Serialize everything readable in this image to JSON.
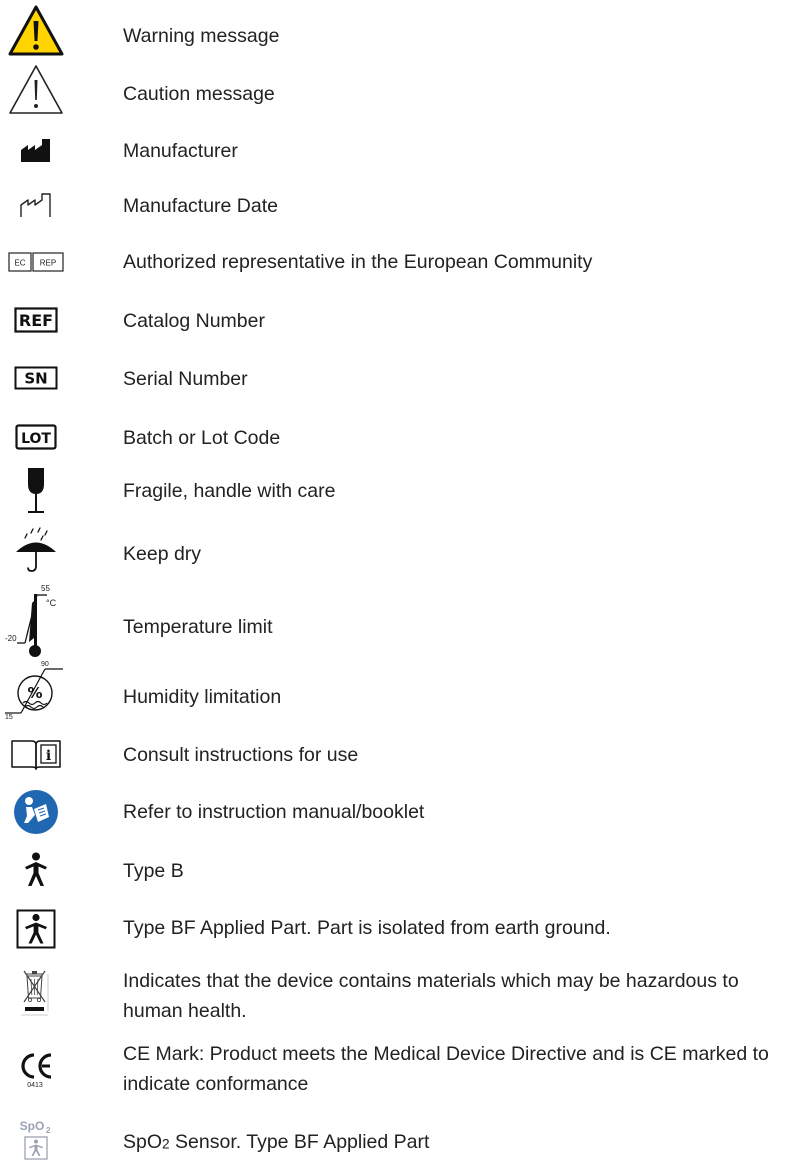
{
  "symbols": [
    {
      "icon": "warning-icon",
      "label": "Warning message"
    },
    {
      "icon": "caution-icon",
      "label": "Caution message"
    },
    {
      "icon": "manufacturer-icon",
      "label": "Manufacturer"
    },
    {
      "icon": "manufacture-date-icon",
      "label": "Manufacture Date"
    },
    {
      "icon": "ec-rep-icon",
      "label": "Authorized representative in the European Community",
      "icon_text": [
        "EC",
        "REP"
      ]
    },
    {
      "icon": "ref-icon",
      "label": "Catalog Number",
      "icon_text": "REF"
    },
    {
      "icon": "sn-icon",
      "label": "Serial Number",
      "icon_text": "SN"
    },
    {
      "icon": "lot-icon",
      "label": "Batch or Lot Code",
      "icon_text": "LOT"
    },
    {
      "icon": "fragile-icon",
      "label": "Fragile, handle with care"
    },
    {
      "icon": "keep-dry-icon",
      "label": "Keep dry"
    },
    {
      "icon": "temperature-limit-icon",
      "label": "Temperature limit",
      "icon_text": {
        "high": "55",
        "unit": "°C",
        "low": "-20"
      }
    },
    {
      "icon": "humidity-limitation-icon",
      "label": "Humidity limitation",
      "icon_text": {
        "high": "90",
        "low": "15",
        "symbol": "%"
      }
    },
    {
      "icon": "consult-instructions-icon",
      "label": "Consult instructions for use",
      "icon_text": "i"
    },
    {
      "icon": "refer-manual-icon",
      "label": "Refer to instruction manual/booklet"
    },
    {
      "icon": "type-b-icon",
      "label": "Type B"
    },
    {
      "icon": "type-bf-icon",
      "label": "Type BF Applied Part. Part is isolated from earth ground."
    },
    {
      "icon": "weee-bin-icon",
      "label": "Indicates that the device contains materials which may be hazardous to human health."
    },
    {
      "icon": "ce-mark-icon",
      "label": "CE Mark:  Product meets the Medical Device Directive and is CE marked to indicate conformance",
      "icon_text": {
        "mark": "CE",
        "number": "0413"
      }
    },
    {
      "icon": "spo2-sensor-icon",
      "label_parts": [
        "SpO",
        "2",
        " Sensor. Type BF Applied Part"
      ],
      "icon_text": [
        "SpO",
        "2"
      ]
    }
  ],
  "colors": {
    "warning_yellow": "#FFD400",
    "manual_blue": "#1F67B1",
    "text": "#222222",
    "spo2_grey": "#9AA3B2"
  }
}
